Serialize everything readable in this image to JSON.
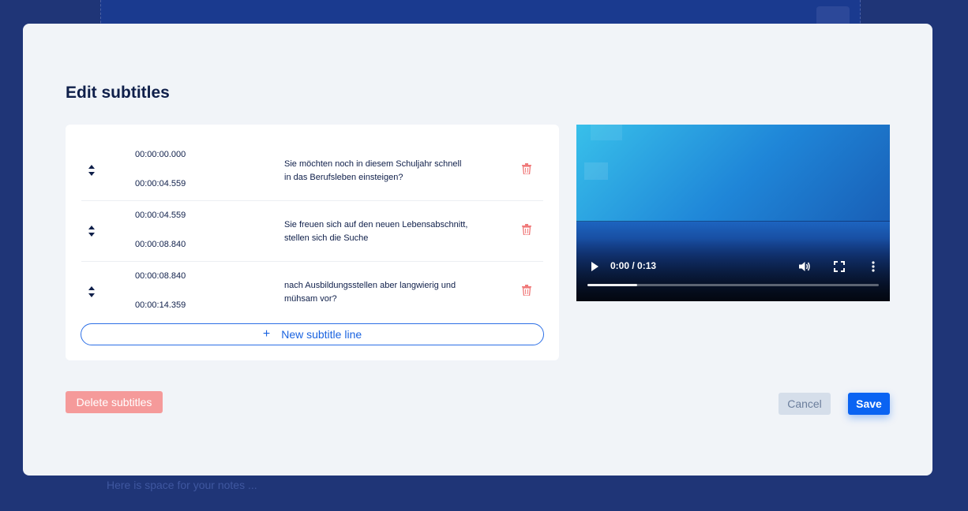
{
  "background": {
    "notes_placeholder": "Here is space for your notes ..."
  },
  "modal": {
    "title": "Edit subtitles"
  },
  "subtitles": [
    {
      "start": "00:00:00.000",
      "end": "00:00:04.559",
      "text": "Sie möchten noch in diesem Schuljahr schnell in das Berufsleben einsteigen?"
    },
    {
      "start": "00:00:04.559",
      "end": "00:00:08.840",
      "text": "Sie freuen sich auf den neuen Lebensabschnitt, stellen sich die Suche"
    },
    {
      "start": "00:00:08.840",
      "end": "00:00:14.359",
      "text": "nach Ausbildungsstellen aber langwierig und mühsam vor?"
    }
  ],
  "new_line": {
    "plus": "+",
    "label": "New subtitle line"
  },
  "video": {
    "time": "0:00 / 0:13",
    "progress_fraction": 0.17
  },
  "footer": {
    "delete_label": "Delete subtitles",
    "cancel_label": "Cancel",
    "save_label": "Save"
  },
  "colors": {
    "accent": "#0a63f2",
    "danger": "#f59a9a",
    "trash": "#f07a7a"
  },
  "icons": {
    "drag": "drag-handle-icon",
    "trash": "trash-icon",
    "play": "play-icon",
    "volume": "volume-icon",
    "fullscreen": "fullscreen-icon",
    "more": "more-vertical-icon"
  }
}
